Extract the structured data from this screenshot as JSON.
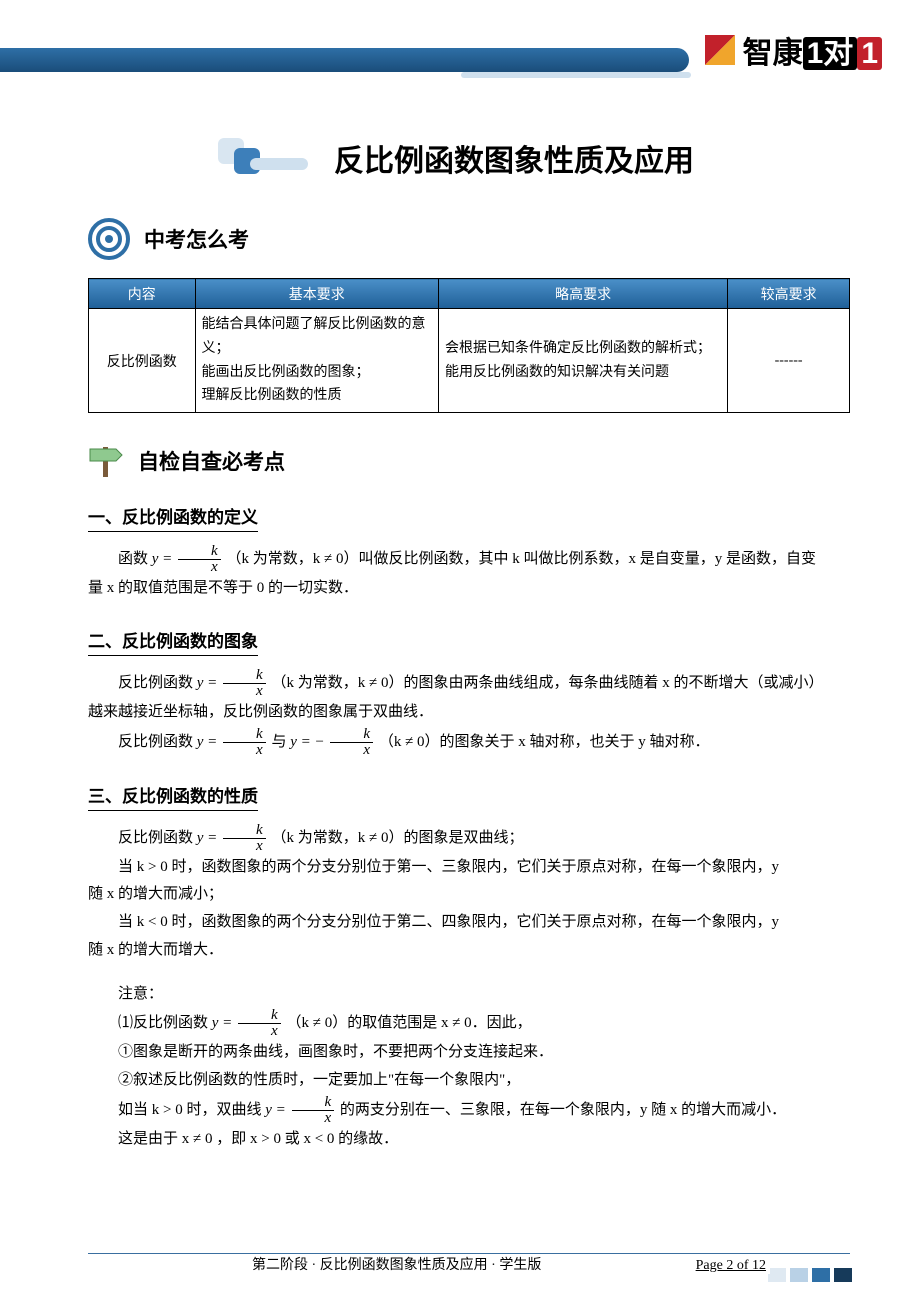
{
  "brand": {
    "name": "智康",
    "badge1": "1对",
    "badge2": "1"
  },
  "page_title": "反比例函数图象性质及应用",
  "section1": {
    "heading": "中考怎么考"
  },
  "table": {
    "headers": [
      "内容",
      "基本要求",
      "略高要求",
      "较高要求"
    ],
    "row": {
      "c1": "反比例函数",
      "c2": "能结合具体问题了解反比例函数的意义；\n能画出反比例函数的图象；\n理解反比例函数的性质",
      "c3": "会根据已知条件确定反比例函数的解析式；\n能用反比例函数的知识解决有关问题",
      "c4": "------"
    }
  },
  "section2": {
    "heading": "自检自查必考点"
  },
  "s2_h1": "一、反比例函数的定义",
  "s2_p1a": "函数 ",
  "s2_p1b": "（k 为常数，k ≠ 0）叫做反比例函数，其中 k 叫做比例系数，x 是自变量，y 是函数，自变",
  "s2_p1c": "量 x 的取值范围是不等于 0 的一切实数．",
  "s2_h2": "二、反比例函数的图象",
  "s2_p2a": "反比例函数 ",
  "s2_p2b": "（k 为常数，k ≠ 0）的图象由两条曲线组成，每条曲线随着 x 的不断增大（或减小）",
  "s2_p2c": "越来越接近坐标轴，反比例函数的图象属于双曲线．",
  "s2_p2d": "反比例函数 ",
  "s2_p2e": " 与 ",
  "s2_p2f": "（k ≠ 0）的图象关于 x 轴对称，也关于 y 轴对称．",
  "s2_h3": "三、反比例函数的性质",
  "s2_p3a": "反比例函数 ",
  "s2_p3b": "（k 为常数，k ≠ 0）的图象是双曲线；",
  "s2_p3c": "当 k > 0 时，函数图象的两个分支分别位于第一、三象限内，它们关于原点对称，在每一个象限内，y",
  "s2_p3c2": "随 x 的增大而减小；",
  "s2_p3d": "当 k < 0 时，函数图象的两个分支分别位于第二、四象限内，它们关于原点对称，在每一个象限内，y",
  "s2_p3d2": "随 x 的增大而增大．",
  "s2_note_head": "注意：",
  "s2_n1a": "⑴反比例函数 ",
  "s2_n1b": "（k ≠ 0）的取值范围是 x ≠ 0．因此，",
  "s2_n2": "①图象是断开的两条曲线，画图象时，不要把两个分支连接起来．",
  "s2_n3": "②叙述反比例函数的性质时，一定要加上\"在每一个象限内\"，",
  "s2_n4a": "如当 k > 0 时，双曲线 ",
  "s2_n4b": " 的两支分别在一、三象限，在每一个象限内，y 随 x 的增大而减小．",
  "s2_n5": "这是由于 x ≠ 0 ，即 x > 0 或 x < 0 的缘故．",
  "footer": {
    "left": "第二阶段 · 反比例函数图象性质及应用 · 学生版",
    "right": "Page 2 of 12"
  }
}
